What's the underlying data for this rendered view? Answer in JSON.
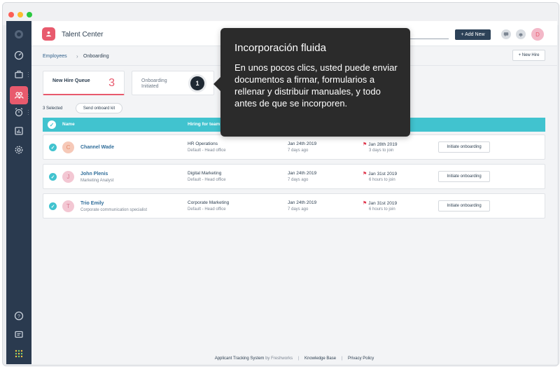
{
  "app": {
    "title": "Talent Center",
    "logo_icon": "user-badge-icon"
  },
  "topbar": {
    "add_new_label": "+ Add New",
    "avatar_initial": "D"
  },
  "breadcrumb": {
    "parent": "Employees",
    "separator": "›",
    "current": "Onboarding"
  },
  "new_hire_button": "+ New Hire",
  "tabs": [
    {
      "label": "New Hire Queue",
      "count": "3",
      "active": true
    },
    {
      "label": "Onboarding Initiated",
      "active": false
    }
  ],
  "step_badge": "1",
  "selection": {
    "text": "3 Selected",
    "action_label": "Send onboard kit"
  },
  "table": {
    "headers": {
      "name": "Name",
      "hiring": "Hiring for team"
    },
    "rows": [
      {
        "initial": "C",
        "avatar_color": "#f6c9b8",
        "avatar_text_color": "#e58b6a",
        "name": "Channel Wade",
        "title": "",
        "team": "HR Operations",
        "team_sub": "Default - Head office",
        "date": "Jan 24th 2019",
        "ago": "7 days ago",
        "join_date": "Jan 28th 2019",
        "join_sub": "3 days to join",
        "action": "Initiate onboarding"
      },
      {
        "initial": "J",
        "avatar_color": "#f3c7d3",
        "avatar_text_color": "#d9798f",
        "name": "John Plenis",
        "title": "Marketing Analyst",
        "team": "Digital Marketing",
        "team_sub": "Default - Head office",
        "date": "Jan 24th 2019",
        "ago": "7 days ago",
        "join_date": "Jan 31st 2019",
        "join_sub": "6 hours to join",
        "action": "Initiate onboarding"
      },
      {
        "initial": "T",
        "avatar_color": "#f3c7d3",
        "avatar_text_color": "#d9798f",
        "name": "Trio Emily",
        "title": "Corporate communication specialist",
        "team": "Corporate Marketing",
        "team_sub": "Default - Head office",
        "date": "Jan 24th 2019",
        "ago": "7 days ago",
        "join_date": "Jan 31st 2019",
        "join_sub": "6 hours to join",
        "action": "Initiate onboarding"
      }
    ]
  },
  "footer": {
    "product": "Applicant Tracking System",
    "by": "by Freshworks",
    "knowledge_base": "Knowledge Base",
    "privacy": "Privacy Policy"
  },
  "tooltip": {
    "title": "Incorporación fluida",
    "body": "En unos pocos clics, usted puede enviar documentos a firmar, formularios a rellenar y distribuir manuales, y todo antes de que se incorporen."
  },
  "sidebar_icons": [
    "freshteam-logo-icon",
    "dashboard-icon",
    "briefcase-icon",
    "people-icon",
    "alarm-clock-icon",
    "report-icon",
    "settings-icon",
    "help-icon",
    "chat-icon",
    "apps-grid-icon"
  ],
  "colors": {
    "accent": "#e85a6d",
    "teal": "#41c3cf",
    "sidebar": "#2a3a4f",
    "tooltip": "#2b2b2b"
  }
}
